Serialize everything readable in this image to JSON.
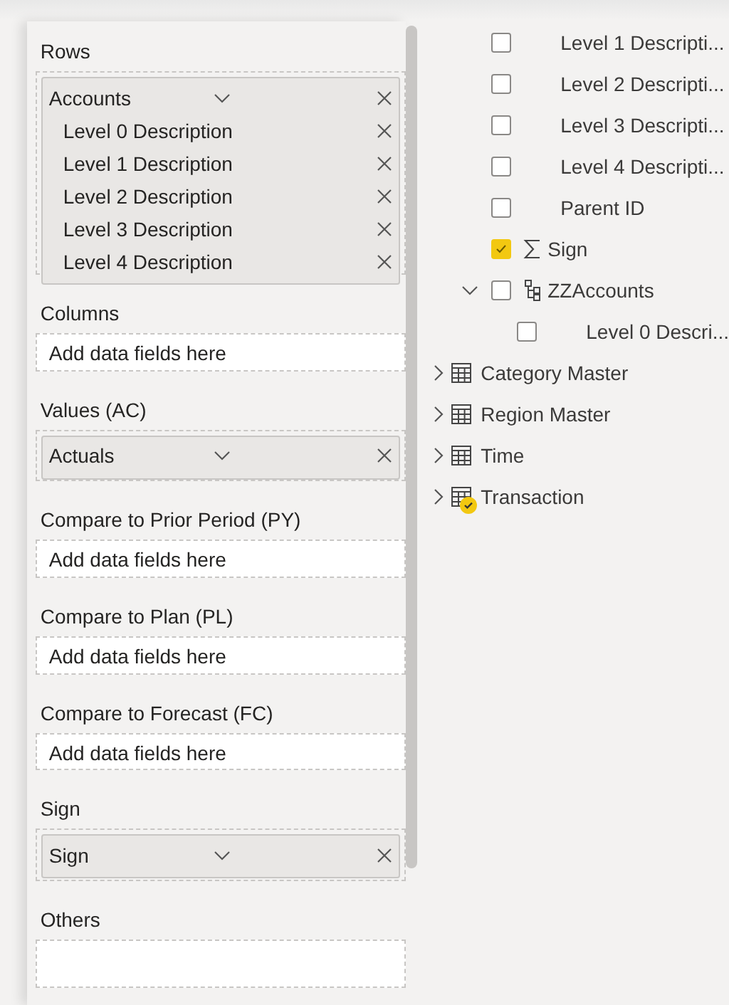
{
  "wells": [
    {
      "label": "Rows",
      "fields": [
        {
          "name": "Accounts",
          "expandable": true,
          "children": [
            {
              "name": "Level 0 Description"
            },
            {
              "name": "Level 1 Description"
            },
            {
              "name": "Level 2 Description"
            },
            {
              "name": "Level 3 Description"
            },
            {
              "name": "Level 4 Description"
            }
          ]
        }
      ]
    },
    {
      "label": "Columns",
      "placeholder": "Add data fields here"
    },
    {
      "label": "Values (AC)",
      "fields": [
        {
          "name": "Actuals",
          "expandable": true
        }
      ]
    },
    {
      "label": "Compare to Prior Period (PY)",
      "placeholder": "Add data fields here"
    },
    {
      "label": "Compare to Plan (PL)",
      "placeholder": "Add data fields here"
    },
    {
      "label": "Compare to Forecast (FC)",
      "placeholder": "Add data fields here"
    },
    {
      "label": "Sign",
      "fields": [
        {
          "name": "Sign",
          "expandable": true
        }
      ]
    },
    {
      "label": "Others"
    }
  ],
  "field_list": {
    "items": [
      {
        "kind": "field",
        "label": "Level 1 Descripti...",
        "checked": false
      },
      {
        "kind": "field",
        "label": "Level 2 Descripti...",
        "checked": false
      },
      {
        "kind": "field",
        "label": "Level 3 Descripti...",
        "checked": false
      },
      {
        "kind": "field",
        "label": "Level 4 Descripti...",
        "checked": false
      },
      {
        "kind": "field",
        "label": "Parent ID",
        "checked": false
      },
      {
        "kind": "measure",
        "label": "Sign",
        "checked": true
      },
      {
        "kind": "hierarchy",
        "label": "ZZAccounts",
        "checked": false,
        "expanded": true,
        "children": [
          {
            "kind": "field",
            "label": "Level 0 Descri...",
            "checked": false
          }
        ]
      }
    ],
    "tables": [
      {
        "label": "Category Master",
        "expanded": false,
        "in_use": false
      },
      {
        "label": "Region Master",
        "expanded": false,
        "in_use": false
      },
      {
        "label": "Time",
        "expanded": false,
        "in_use": false
      },
      {
        "label": "Transaction",
        "expanded": false,
        "in_use": true
      }
    ]
  }
}
